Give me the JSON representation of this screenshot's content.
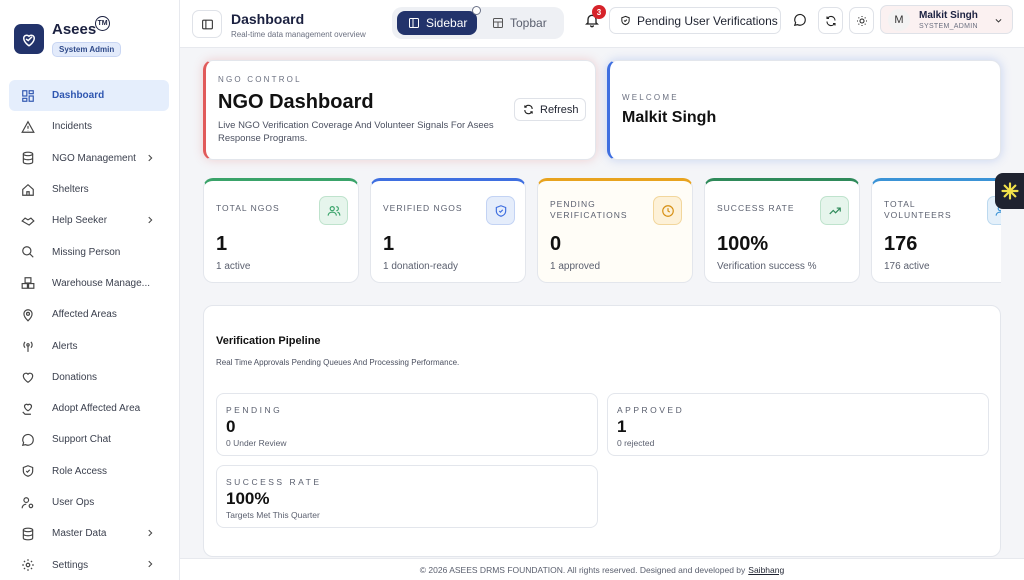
{
  "brand": {
    "name": "Asees",
    "tm": "TM",
    "role_badge": "System Admin"
  },
  "sidebar": {
    "items": [
      {
        "label": "Dashboard",
        "icon": "grid-icon",
        "active": true
      },
      {
        "label": "Incidents",
        "icon": "warning-icon"
      },
      {
        "label": "NGO Management",
        "icon": "database-icon",
        "has_submenu": true
      },
      {
        "label": "Shelters",
        "icon": "home-icon"
      },
      {
        "label": "Help Seeker",
        "icon": "handshake-icon",
        "has_submenu": true
      },
      {
        "label": "Missing Person",
        "icon": "search-icon"
      },
      {
        "label": "Warehouse Manage...",
        "icon": "boxes-icon"
      },
      {
        "label": "Affected Areas",
        "icon": "map-pin-icon"
      },
      {
        "label": "Alerts",
        "icon": "broadcast-icon"
      },
      {
        "label": "Donations",
        "icon": "heart-icon"
      },
      {
        "label": "Adopt Affected Area",
        "icon": "heart-hand-icon"
      },
      {
        "label": "Support Chat",
        "icon": "chat-icon"
      },
      {
        "label": "Role Access",
        "icon": "shield-check-icon"
      },
      {
        "label": "User Ops",
        "icon": "user-gear-icon"
      },
      {
        "label": "Master Data",
        "icon": "database-icon",
        "has_submenu": true
      },
      {
        "label": "Settings",
        "icon": "gear-icon",
        "has_submenu": true
      }
    ]
  },
  "topbar": {
    "title": "Dashboard",
    "subtitle": "Real-time data management overview",
    "layout_sidebar": "Sidebar",
    "layout_topbar": "Topbar",
    "notification_count": "3",
    "pending_button": "Pending User Verifications",
    "user": {
      "initial": "M",
      "name": "Malkit Singh",
      "role": "SYSTEM_ADMIN"
    }
  },
  "hero": {
    "kicker": "NGO CONTROL",
    "title": "NGO Dashboard",
    "description": "Live NGO Verification Coverage And Volunteer Signals For Asees Response Programs.",
    "refresh_label": "Refresh"
  },
  "welcome": {
    "kicker": "WELCOME",
    "name": "Malkit Singh"
  },
  "stats": [
    {
      "label": "TOTAL NGOS",
      "value": "1",
      "sub": "1 active",
      "color": "#3aa36a",
      "icon": "users-icon"
    },
    {
      "label": "VERIFIED NGOS",
      "value": "1",
      "sub": "1 donation-ready",
      "color": "#3f6fe0",
      "icon": "shield-check-icon"
    },
    {
      "label": "PENDING VERIFICATIONS",
      "value": "0",
      "sub": "1 approved",
      "color": "#e8a31f",
      "icon": "clock-icon"
    },
    {
      "label": "SUCCESS RATE",
      "value": "100%",
      "sub": "Verification success %",
      "color": "#2f8a5a",
      "icon": "trending-up-icon"
    },
    {
      "label": "TOTAL VOLUNTEERS",
      "value": "176",
      "sub": "176 active",
      "color": "#3b93d6",
      "icon": "users-icon"
    }
  ],
  "pipeline": {
    "title": "Verification Pipeline",
    "subtitle": "Real Time Approvals Pending Queues And Processing Performance.",
    "boxes": [
      {
        "key": "PENDING",
        "value": "0",
        "sub": "0 Under Review"
      },
      {
        "key": "APPROVED",
        "value": "1",
        "sub": "0 rejected"
      },
      {
        "key": "SUCCESS RATE",
        "value": "100%",
        "sub": "Targets Met This Quarter"
      }
    ]
  },
  "footer": {
    "text": "© 2026 ASEES DRMS FOUNDATION. All rights reserved. Designed and developed by",
    "link": "Saibhang"
  }
}
